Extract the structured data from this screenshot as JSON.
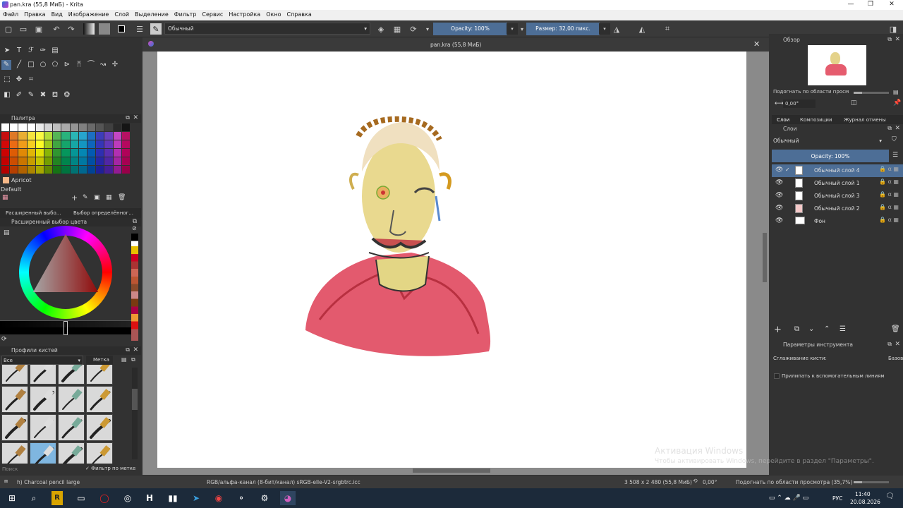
{
  "window": {
    "title": "pan.kra (55,8 МиБ)  - Krita",
    "min": "—",
    "max": "❐",
    "close": "✕"
  },
  "menu": [
    "Файл",
    "Правка",
    "Вид",
    "Изображение",
    "Слой",
    "Выделение",
    "Фильтр",
    "Сервис",
    "Настройка",
    "Окно",
    "Справка"
  ],
  "toolbar": {
    "blend_mode": "Обычный",
    "opacity": "Opacity: 100%",
    "size": "Размер: 32,00 пикс."
  },
  "document_tab": {
    "title": "pan.kra (55,8 МиБ)"
  },
  "palette": {
    "title": "Палитра",
    "selected_color_name": "Apricot",
    "palette_name": "Default",
    "colors": [
      "#ffffff",
      "#e6e6e6",
      "#cccccc",
      "#b3b3b3",
      "#999999",
      "#808080",
      "#666666",
      "#4d4d4d",
      "#333333",
      "#1a1a1a",
      "#000000",
      "#f8f8f8",
      "#e8e8e8",
      "#d0d0d0",
      "#b8b8b8",
      "#a0a0a0",
      "#888888",
      "#707070",
      "#585858",
      "#404040",
      "#282828",
      "#101010"
    ]
  },
  "color_tabs": [
    "Расширенный выбо...",
    "Выбор определённог..."
  ],
  "adv_color": {
    "title": "Расширенный выбор цвета"
  },
  "brush_presets": {
    "title": "Профили кистей",
    "filter": "Все",
    "tag": "Метка",
    "search": "Поиск",
    "filter_by_tag": "Фильтр по метке"
  },
  "overview": {
    "title": "Обзор",
    "fit": "Подогнать по области просм",
    "angle": "0,00°"
  },
  "right_tabs": [
    "Слои",
    "Композиции",
    "Журнал отмены"
  ],
  "layers": {
    "title": "Слои",
    "blend": "Обычный",
    "opacity": "Opacity: 100%",
    "items": [
      {
        "name": "Обычный слой 4",
        "selected": true
      },
      {
        "name": "Обычный слой 1",
        "selected": false
      },
      {
        "name": "Обычный слой 3",
        "selected": false
      },
      {
        "name": "Обычный слой 2",
        "selected": false
      },
      {
        "name": "Фон",
        "selected": false
      }
    ]
  },
  "tool_options": {
    "title": "Параметры инструмента",
    "smoothing_label": "Сглаживание кисти:",
    "smoothing_value": "Базов",
    "snap_label": "Прилипать к вспомогательным линиям"
  },
  "watermark": {
    "line1": "Активация Windows",
    "line2": "Чтобы активировать Windows, перейдите в раздел \"Параметры\"."
  },
  "status": {
    "brush": "h) Charcoal pencil large",
    "colorspace": "RGB/альфа-канал (8-бит/канал)  sRGB-elle-V2-srgbtrc.icc",
    "dims": "3 508 x 2 480 (55,8 МиБ)",
    "rotation": "0,00°",
    "zoom": "Подогнать по области просмотра (35,7%)"
  },
  "taskbar": {
    "lang": "РУС",
    "time": "11:40",
    "date": "20.08.2026"
  }
}
